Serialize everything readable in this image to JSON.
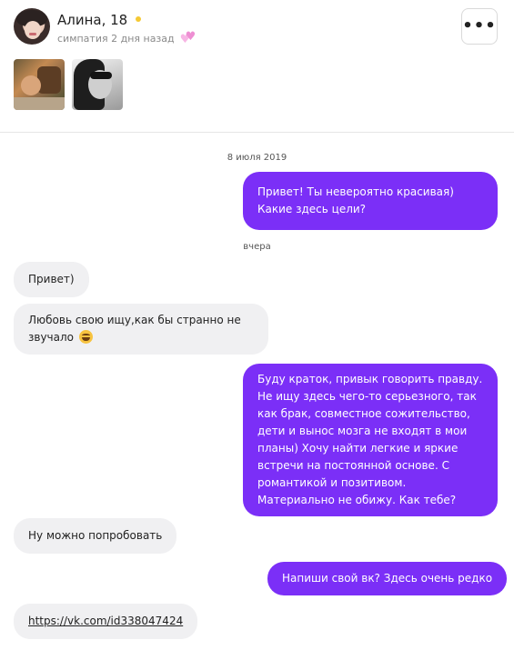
{
  "profile": {
    "name": "Алина, 18",
    "sympathy_text": "симпатия 2 дня назад"
  },
  "dates": [
    "8 июля 2019",
    "вчера"
  ],
  "messages": [
    {
      "side": "out",
      "text": "Привет! Ты невероятно красивая) Какие здесь цели?"
    },
    {
      "side": "in",
      "text": "Привет)"
    },
    {
      "side": "in",
      "text": "Любовь свою ищу,как бы странно не звучало",
      "emoji": "tears-of-joy-icon"
    },
    {
      "side": "out",
      "text": "Буду краток, привык говорить правду. Не ищу здесь чего-то серьезного, так как брак, совместное сожительство, дети и вынос мозга не входят в мои планы) Хочу найти легкие и яркие встречи на постоянной основе. С романтикой и позитивом. Материально не обижу. Как тебе?"
    },
    {
      "side": "in",
      "text": "Ну можно попробовать"
    },
    {
      "side": "out",
      "text": "Напиши свой вк? Здесь очень редко"
    },
    {
      "side": "in",
      "text": "https://vk.com/id338047424"
    }
  ],
  "colors": {
    "outgoing_bubble": "#7b2ff7",
    "incoming_bubble": "#f0f0f2",
    "online_dot": "#f5c933",
    "hearts": "#ee8fd3"
  }
}
